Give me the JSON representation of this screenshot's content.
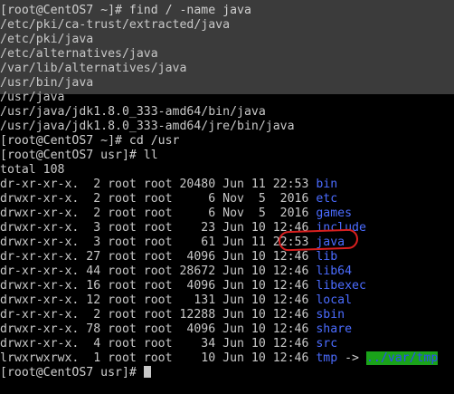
{
  "terminal": {
    "lines": [
      {
        "text": "[root@CentOS7 ~]# find / -name java"
      },
      {
        "text": "/etc/pki/ca-trust/extracted/java"
      },
      {
        "text": "/etc/pki/java"
      },
      {
        "text": "/etc/alternatives/java"
      },
      {
        "text": "/var/lib/alternatives/java"
      },
      {
        "text": "/usr/bin/java"
      },
      {
        "text": "/usr/java"
      },
      {
        "text": "/usr/java/jdk1.8.0_333-amd64/bin/java"
      },
      {
        "text": "/usr/java/jdk1.8.0_333-amd64/jre/bin/java"
      },
      {
        "text": "[root@CentOS7 ~]# cd /usr"
      },
      {
        "text": "[root@CentOS7 usr]# ll"
      },
      {
        "text": "total 108"
      }
    ],
    "listing": [
      {
        "meta": "dr-xr-xr-x.  2 root root 20480 Jun 11 22:53 ",
        "name": "bin"
      },
      {
        "meta": "drwxr-xr-x.  2 root root     6 Nov  5  2016 ",
        "name": "etc"
      },
      {
        "meta": "drwxr-xr-x.  2 root root     6 Nov  5  2016 ",
        "name": "games"
      },
      {
        "meta": "drwxr-xr-x.  3 root root    23 Jun 10 12:46 ",
        "name": "include"
      },
      {
        "meta": "drwxr-xr-x.  3 root root    61 Jun 11 22:53 ",
        "name": "java"
      },
      {
        "meta": "dr-xr-xr-x. 27 root root  4096 Jun 10 12:46 ",
        "name": "lib"
      },
      {
        "meta": "dr-xr-xr-x. 44 root root 28672 Jun 10 12:46 ",
        "name": "lib64"
      },
      {
        "meta": "drwxr-xr-x. 16 root root  4096 Jun 10 12:46 ",
        "name": "libexec"
      },
      {
        "meta": "drwxr-xr-x. 12 root root   131 Jun 10 12:46 ",
        "name": "local"
      },
      {
        "meta": "dr-xr-xr-x.  2 root root 12288 Jun 10 12:46 ",
        "name": "sbin"
      },
      {
        "meta": "drwxr-xr-x. 78 root root  4096 Jun 10 12:46 ",
        "name": "share"
      },
      {
        "meta": "drwxr-xr-x.  4 root root    34 Jun 10 12:46 ",
        "name": "src"
      }
    ],
    "tmp_row": {
      "meta": "lrwxrwxrwx.  1 root root    10 Jun 10 12:46 ",
      "name": "tmp",
      "arrow": " -> ",
      "target": "../var/tmp"
    },
    "final_prompt": "[root@CentOS7 usr]# "
  },
  "colors": {
    "background": "#000000",
    "text": "#c8c8c8",
    "directory": "#4b6cff",
    "symlink_target_bg": "#1aa31a",
    "annotation": "#d81f1f"
  }
}
